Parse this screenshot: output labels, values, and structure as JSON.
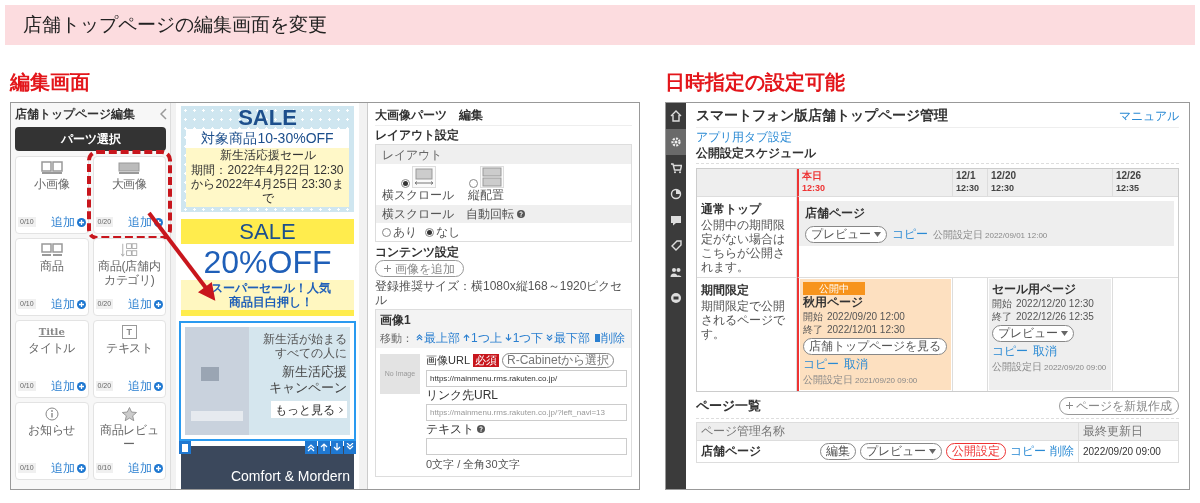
{
  "banner_title": "店舗トップページの編集画面を変更",
  "editor_section": {
    "heading": "編集画面",
    "sidebar": {
      "title": "店舗トップページ編集",
      "parts_button": "パーツ選択",
      "parts": [
        {
          "label": "小画像",
          "kind": "small-image",
          "count": "0/10",
          "add": "追加",
          "highlighted": false
        },
        {
          "label": "大画像",
          "kind": "large-image",
          "count": "0/20",
          "add": "追加",
          "highlighted": true
        },
        {
          "label": "商品",
          "kind": "product",
          "count": "0/10",
          "add": "追加",
          "highlighted": false
        },
        {
          "label": "商品(店舗内カテゴリ)",
          "kind": "category",
          "count": "0/20",
          "add": "追加",
          "highlighted": false
        },
        {
          "label": "タイトル",
          "kind": "title",
          "icon_text": "Title",
          "count": "0/10",
          "add": "追加",
          "highlighted": false
        },
        {
          "label": "テキスト",
          "kind": "text",
          "icon_text": "T",
          "count": "0/20",
          "add": "追加",
          "highlighted": false
        },
        {
          "label": "お知らせ",
          "kind": "info",
          "count": "0/10",
          "add": "追加",
          "highlighted": false
        },
        {
          "label": "商品レビュー",
          "kind": "star",
          "count": "0/10",
          "add": "追加",
          "highlighted": false
        }
      ]
    },
    "preview": [
      {
        "kind": "sale-dots",
        "selected": false,
        "title": "SALE",
        "headline": "対象商品10-30%OFF",
        "note": "新生活応援セール",
        "period": "期間：2022年4月22日 12:30から2022年4月25日 23:30まで"
      },
      {
        "kind": "sale-stripes",
        "selected": false,
        "title": "SALE",
        "headline": "20%OFF",
        "note": "スーパーセール！人気商品目白押し！"
      },
      {
        "kind": "campaign",
        "selected": true,
        "subtitle": [
          "新生活が始まる",
          "すべての人に"
        ],
        "headline": [
          "新生活応援",
          "キャンペーン"
        ],
        "button": "もっと見る"
      },
      {
        "kind": "photo",
        "selected": false,
        "caption": "Comfort & Mordern"
      }
    ],
    "panel": {
      "title": "大画像パーツ　編集",
      "layout_heading": "レイアウト設定",
      "layout_label": "レイアウト",
      "layout_options": [
        {
          "label": "横スクロール",
          "kind": "horizontal",
          "selected": true
        },
        {
          "label": "縦配置",
          "kind": "vertical",
          "selected": false
        }
      ],
      "autorotate_label": "横スクロール　自動回転",
      "autorotate_options": [
        {
          "label": "あり",
          "selected": false
        },
        {
          "label": "なし",
          "selected": true
        }
      ],
      "content_heading": "コンテンツ設定",
      "add_image": "画像を追加",
      "size_note": "登録推奨サイズ：横1080x縦168～1920ピクセル",
      "image_card": {
        "title": "画像1",
        "move_label": "移動：",
        "moves": [
          {
            "label": "最上部",
            "kind": "top"
          },
          {
            "label": "1つ上",
            "kind": "up"
          },
          {
            "label": "1つ下",
            "kind": "down"
          },
          {
            "label": "最下部",
            "kind": "bottom"
          }
        ],
        "delete": "削除",
        "thumb": "No Image",
        "url_label": "画像URL",
        "required": "必須",
        "cabinet": "R-Cabinetから選択",
        "url_value": "https://mainmenu.rms.rakuten.co.jp/",
        "link_label": "リンク先URL",
        "link_placeholder": "https://mainmenu.rms.rakuten.co.jp/?left_navi=13",
        "text_label": "テキスト",
        "char_count": "0文字 / 全角30文字"
      }
    }
  },
  "schedule_section": {
    "heading": "日時指定の設定可能",
    "nav": [
      {
        "kind": "home",
        "selected": false
      },
      {
        "kind": "gear",
        "selected": true
      },
      {
        "kind": "cart",
        "selected": false
      },
      {
        "kind": "pie",
        "selected": false
      },
      {
        "kind": "chat",
        "selected": false
      },
      {
        "kind": "tag",
        "selected": false
      },
      {
        "kind": "people",
        "selected": false
      },
      {
        "kind": "circle",
        "selected": false
      }
    ],
    "title": "スマートフォン版店舗トップページ管理",
    "manual": "マニュアル",
    "app_tab": "アプリ用タブ設定",
    "schedule_heading": "公開設定スケジュール",
    "columns": [
      {
        "date": "本日",
        "time": "12:30",
        "today": true
      },
      {
        "date": "12/1",
        "time": "12:30",
        "today": false
      },
      {
        "date": "12/20",
        "time": "12:30",
        "today": false
      },
      {
        "date": "12/26",
        "time": "12:35",
        "today": false
      }
    ],
    "rows": [
      {
        "name": "通常トップ",
        "description": "公開中の期間限定がない場合はこちらが公開されます。",
        "cells": [
          {
            "kind": "standing",
            "title": "店舗ページ",
            "preview": "プレビュー",
            "copy": "コピー",
            "published_label": "公開設定日",
            "published": "2022/09/01 12:00"
          }
        ]
      },
      {
        "name": "期間限定",
        "description": "期間限定で公開されるページです。",
        "cells": [
          {
            "kind": "active",
            "status": "公開中",
            "title": "秋用ページ",
            "start_label": "開始",
            "start": "2022/09/20 12:00",
            "end_label": "終了",
            "end": "2022/12/01 12:30",
            "view": "店舗トップページを見る",
            "copy": "コピー",
            "cancel": "取消",
            "published_label": "公開設定日",
            "published": "2021/09/20 09:00"
          },
          null,
          {
            "kind": "scheduled",
            "title": "セール用ページ",
            "start_label": "開始",
            "start": "2022/12/20 12:30",
            "end_label": "終了",
            "end": "2022/12/26 12:35",
            "preview": "プレビュー",
            "copy": "コピー",
            "cancel": "取消",
            "published_label": "公開設定日",
            "published": "2022/09/20 09:00"
          },
          null
        ]
      }
    ],
    "pages": {
      "heading": "ページ一覧",
      "new_button": "ページを新規作成",
      "columns": [
        "ページ管理名称",
        "最終更新日"
      ],
      "rows": [
        {
          "name": "店舗ページ",
          "edit": "編集",
          "preview": "プレビュー",
          "publish": "公開設定",
          "copy": "コピー",
          "delete": "削除",
          "updated": "2022/09/20 09:00"
        }
      ]
    }
  }
}
